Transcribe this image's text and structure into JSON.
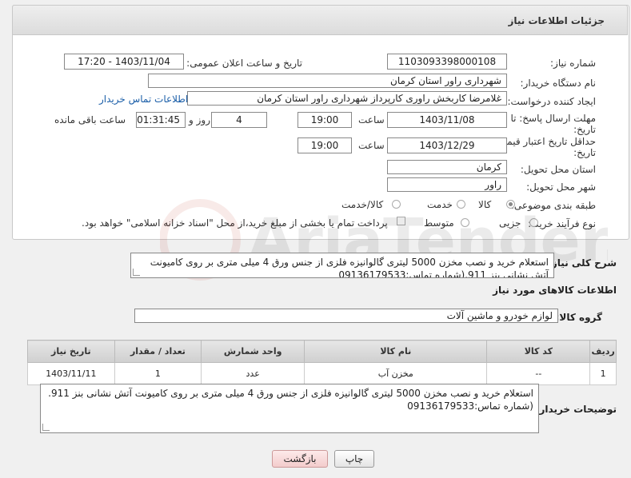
{
  "header": {
    "title": "جزئیات اطلاعات نیاز"
  },
  "form": {
    "need_number_label": "شماره نیاز:",
    "need_number": "1103093398000108",
    "announce_label": "تاریخ و ساعت اعلان عمومی:",
    "announce_value": "1403/11/04 - 17:20",
    "buyer_org_label": "نام دستگاه خریدار:",
    "buyer_org": "شهرداری راور استان کرمان",
    "creator_label": "ایجاد کننده درخواست:",
    "creator": "غلامرضا کاربخش راوری کارپرداز  شهرداری راور استان کرمان",
    "contact_link": "اطلاعات تماس خریدار",
    "deadline_label": "مهلت ارسال پاسخ: تا",
    "deadline_label2": "تاریخ:",
    "deadline_date": "1403/11/08",
    "time_label": "ساعت",
    "deadline_time": "19:00",
    "days_value": "4",
    "days_label": "روز و",
    "remaining_value": "01:31:45",
    "remaining_label": "ساعت باقی مانده",
    "validity_label": "حداقل تاریخ اعتبار قیمت: تا",
    "validity_label2": "تاریخ:",
    "validity_date": "1403/12/29",
    "validity_time_label": "ساعت",
    "validity_time": "19:00",
    "province_label": "استان محل تحویل:",
    "province": "کرمان",
    "city_label": "شهر محل تحویل:",
    "city": "راور",
    "category_label": "طبقه بندی موضوعی:",
    "category_goods": "کالا",
    "category_service": "خدمت",
    "category_both": "کالا/خدمت",
    "process_label": "نوع فرآیند خرید :",
    "process_partial": "جزیی",
    "process_medium": "متوسط",
    "payment_note": "پرداخت تمام یا بخشی از مبلغ خرید،از محل \"اسناد خزانه اسلامی\" خواهد بود."
  },
  "description": {
    "label": "شرح کلی نیاز:",
    "text": "استعلام خرید و نصب مخزن 5000 لیتری گالوانیزه فلزی از جنس ورق 4 میلی متری بر روی کامیونت آتش نشانی بنز 911.(شماره تماس:09136179533"
  },
  "goods": {
    "section_title": "اطلاعات کالاهای مورد نیاز",
    "group_label": "گروه کالا:",
    "group_value": "لوازم خودرو و ماشین آلات",
    "columns": [
      "ردیف",
      "کد کالا",
      "نام کالا",
      "واحد شمارش",
      "تعداد / مقدار",
      "تاریخ نیاز"
    ],
    "rows": [
      {
        "index": "1",
        "code": "--",
        "name": "مخزن آب",
        "unit": "عدد",
        "qty": "1",
        "date": "1403/11/11"
      }
    ]
  },
  "buyer_notes": {
    "label": "توضیحات خریدار:",
    "text": "استعلام خرید و نصب مخزن 5000 لیتری گالوانیزه فلزی از جنس ورق 4 میلی متری بر روی کامیونت آتش نشانی بنز 911.(شماره تماس:09136179533"
  },
  "buttons": {
    "print": "چاپ",
    "back": "بازگشت"
  },
  "watermark": {
    "text": "AriaTender.neT"
  },
  "colors": {
    "link": "#1a5ea8",
    "back_button": "#f3cccc"
  }
}
